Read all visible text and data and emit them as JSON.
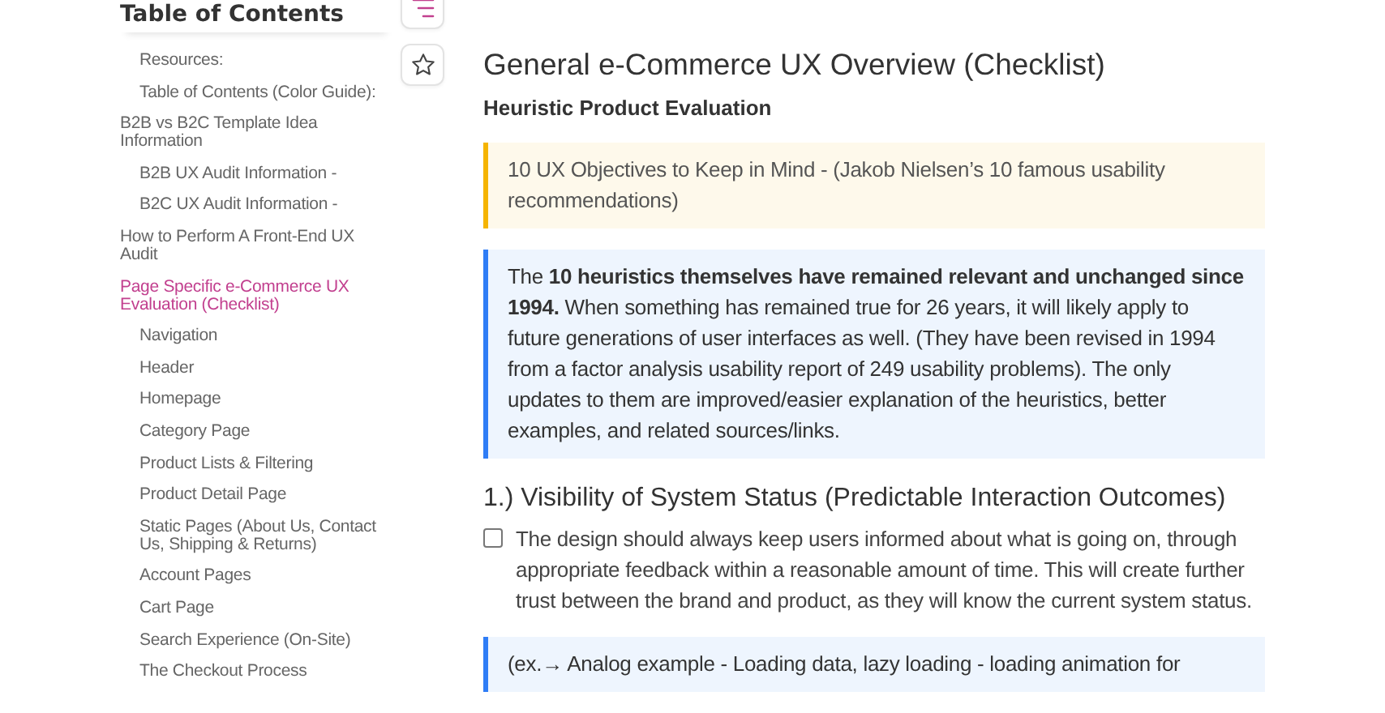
{
  "toc": {
    "title": "Table of Contents",
    "continued_children": [
      {
        "label": "Resources:",
        "selected": false
      },
      {
        "label": "Table of Contents (Color Guide):",
        "selected": false
      }
    ],
    "items": [
      {
        "label": "B2B vs B2C Template Idea Information",
        "selected": false,
        "children": [
          {
            "label": "B2B UX Audit Information -",
            "selected": false
          },
          {
            "label": "B2C UX Audit Information -",
            "selected": false
          }
        ]
      },
      {
        "label": "How to Perform A Front-End UX Audit",
        "selected": false
      },
      {
        "label": "Page Specific e-Commerce UX Evaluation (Checklist)",
        "selected": true,
        "children": [
          {
            "label": "Navigation",
            "selected": false
          },
          {
            "label": "Header",
            "selected": false
          },
          {
            "label": "Homepage",
            "selected": false
          },
          {
            "label": "Category Page",
            "selected": false
          },
          {
            "label": "Product Lists & Filtering",
            "selected": false
          },
          {
            "label": "Product Detail Page",
            "selected": false
          },
          {
            "label": "Static Pages (About Us, Contact Us, Shipping & Returns)",
            "selected": false
          },
          {
            "label": "Account Pages",
            "selected": false
          },
          {
            "label": "Cart Page",
            "selected": false
          },
          {
            "label": "Search Experience (On-Site)",
            "selected": false
          },
          {
            "label": "The Checkout Process",
            "selected": false
          }
        ]
      }
    ]
  },
  "content": {
    "title": "General e-Commerce UX Overview (Checklist)",
    "subtitle": "Heuristic Product Evaluation",
    "blocks": [
      {
        "kind": "callout",
        "color": "#f5b400",
        "text": "10 UX Objectives to Keep in Mind - (Jakob Nielsen’s 10 famous usability recommendations)"
      },
      {
        "kind": "callout",
        "color": "#2f7df6",
        "text": "The **10 heuristics themselves have remained relevant and unchanged since 1994.** When something has remained true for 26 years, it will likely apply to future generations of user interfaces as well. (They have been revised in 1994 from a factor analysis usability report of 249 usability problems). The only updates to them are improved/easier explanation of the heuristics, better examples, and related sources/links."
      },
      {
        "kind": "heading",
        "text": "1.) Visibility of System Status (Predictable Interaction Outcomes)"
      },
      {
        "kind": "todo",
        "checked": false,
        "text": "The design should always keep users informed about what is going on, through appropriate feedback within a reasonable amount of time. This will create further trust between the brand and product, as they will know the current system status."
      },
      {
        "kind": "callout",
        "color": "#2f7df6",
        "text": "(ex.→ Analog example - Loading data, lazy loading - loading animation for"
      }
    ]
  }
}
